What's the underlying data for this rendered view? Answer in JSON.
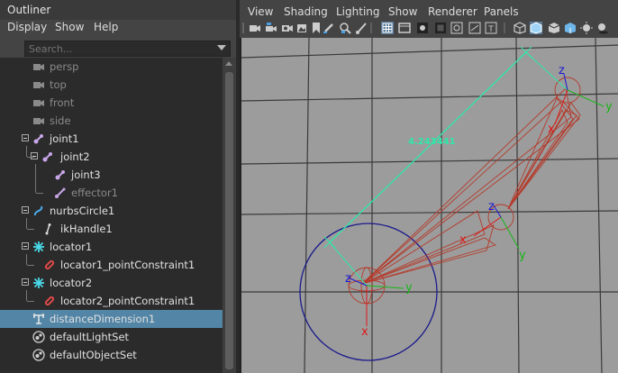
{
  "outliner": {
    "title": "Outliner",
    "menu": [
      "Display",
      "Show",
      "Help"
    ],
    "search_placeholder": "Search...",
    "items": [
      {
        "label": "persp",
        "icon": "camera-icon",
        "dim": true
      },
      {
        "label": "top",
        "icon": "camera-icon",
        "dim": true
      },
      {
        "label": "front",
        "icon": "camera-icon",
        "dim": true
      },
      {
        "label": "side",
        "icon": "camera-icon",
        "dim": true
      },
      {
        "label": "joint1",
        "icon": "joint-icon",
        "dim": false
      },
      {
        "label": "joint2",
        "icon": "joint-icon",
        "dim": false
      },
      {
        "label": "joint3",
        "icon": "joint-icon",
        "dim": false
      },
      {
        "label": "effector1",
        "icon": "effector-icon",
        "dim": true
      },
      {
        "label": "nurbsCircle1",
        "icon": "nurbs-curve-icon",
        "dim": false
      },
      {
        "label": "ikHandle1",
        "icon": "ik-handle-icon",
        "dim": false
      },
      {
        "label": "locator1",
        "icon": "locator-icon",
        "dim": false
      },
      {
        "label": "locator1_pointConstraint1",
        "icon": "constraint-icon",
        "dim": false
      },
      {
        "label": "locator2",
        "icon": "locator-icon",
        "dim": false
      },
      {
        "label": "locator2_pointConstraint1",
        "icon": "constraint-icon",
        "dim": false
      },
      {
        "label": "distanceDimension1",
        "icon": "distance-dimension-icon",
        "dim": false,
        "selected": true
      },
      {
        "label": "defaultLightSet",
        "icon": "set-icon",
        "dim": false
      },
      {
        "label": "defaultObjectSet",
        "icon": "set-icon",
        "dim": false
      }
    ]
  },
  "viewport": {
    "menu": [
      "View",
      "Shading",
      "Lighting",
      "Show",
      "Renderer",
      "Panels"
    ],
    "distance_label": "4.243441",
    "axis_labels": {
      "x": "x",
      "y": "y",
      "z": "z"
    },
    "colors": {
      "background": "#9c9c9c",
      "grid": "#3a3a3a",
      "distance": "#2ee8a8",
      "joint": "#b43a2a",
      "circle": "#1a1a8c",
      "axis_x": "#e01818",
      "axis_y": "#14b814",
      "axis_z": "#1a1ad0"
    }
  }
}
